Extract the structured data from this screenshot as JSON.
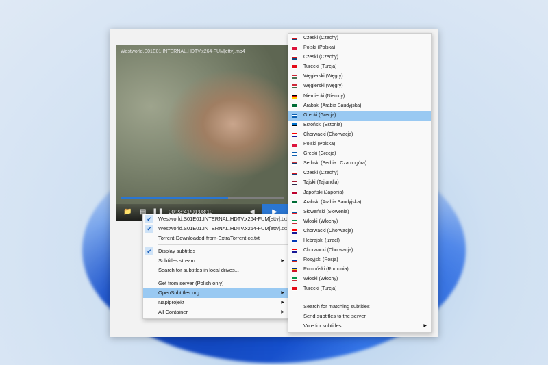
{
  "video": {
    "title": "Westworld.S01E01.INTERNAL.HDTV.x264-FUM[ettv].mp4",
    "time": "00:23:41/01:08:10",
    "progress": 0.66
  },
  "context_menu": {
    "items": [
      {
        "label": "Westworld.S01E01.INTERNAL.HDTV.x264-FUM[ettv].txt",
        "checked": true,
        "submenu": false
      },
      {
        "label": "Westworld.S01E01.INTERNAL.HDTV.x264-FUM[ettv].txt",
        "checked": true,
        "submenu": false
      },
      {
        "label": "Torrent-Downloaded-from-ExtraTorrent.cc.txt",
        "checked": false,
        "submenu": false
      },
      {
        "label": "Display subtitles",
        "checked": true,
        "submenu": false
      },
      {
        "label": "Subtitles stream",
        "checked": false,
        "submenu": true
      },
      {
        "label": "Search for subtitles in local drives...",
        "checked": false,
        "submenu": false
      },
      {
        "label": "Get from server (Polish only)",
        "checked": false,
        "submenu": false
      },
      {
        "label": "OpenSubtitles.org",
        "checked": false,
        "submenu": true
      },
      {
        "label": "Napiprojekt",
        "checked": false,
        "submenu": true
      },
      {
        "label": "All Container",
        "checked": false,
        "submenu": true
      }
    ]
  },
  "languages": [
    {
      "label": "Czeski (Czechy)",
      "flag": [
        "#ffffff",
        "#d7141a",
        "#11457e"
      ]
    },
    {
      "label": "Polski (Polska)",
      "flag": [
        "#ffffff",
        "#dc143c",
        "#dc143c"
      ]
    },
    {
      "label": "Czeski (Czechy)",
      "flag": [
        "#ffffff",
        "#d7141a",
        "#11457e"
      ]
    },
    {
      "label": "Turecki (Turcja)",
      "flag": [
        "#e30a17",
        "#e30a17",
        "#ffffff"
      ]
    },
    {
      "label": "Węgierski (Węgry)",
      "flag": [
        "#ce2939",
        "#ffffff",
        "#477050"
      ]
    },
    {
      "label": "Węgierski (Węgry)",
      "flag": [
        "#ce2939",
        "#ffffff",
        "#477050"
      ]
    },
    {
      "label": "Niemiecki (Niemcy)",
      "flag": [
        "#000000",
        "#dd0000",
        "#ffce00"
      ]
    },
    {
      "label": "Arabski (Arabia Saudyjska)",
      "flag": [
        "#006c35",
        "#006c35",
        "#ffffff"
      ]
    },
    {
      "label": "Grecki (Grecja)",
      "flag": [
        "#0d5eaf",
        "#ffffff",
        "#0d5eaf"
      ]
    },
    {
      "label": "Estoński (Estonia)",
      "flag": [
        "#0072ce",
        "#000000",
        "#ffffff"
      ]
    },
    {
      "label": "Chorwacki (Chorwacja)",
      "flag": [
        "#ff0000",
        "#ffffff",
        "#171796"
      ]
    },
    {
      "label": "Polski (Polska)",
      "flag": [
        "#ffffff",
        "#dc143c",
        "#dc143c"
      ]
    },
    {
      "label": "Grecki (Grecja)",
      "flag": [
        "#0d5eaf",
        "#ffffff",
        "#0d5eaf"
      ]
    },
    {
      "label": "Serbski (Serbia i Czarnogóra)",
      "flag": [
        "#c6363c",
        "#0c4076",
        "#ffffff"
      ]
    },
    {
      "label": "Czeski (Czechy)",
      "flag": [
        "#ffffff",
        "#d7141a",
        "#11457e"
      ]
    },
    {
      "label": "Tajski (Tajlandia)",
      "flag": [
        "#a51931",
        "#ffffff",
        "#2d2a4a"
      ]
    },
    {
      "label": "Japoński (Japonia)",
      "flag": [
        "#ffffff",
        "#bc002d",
        "#ffffff"
      ]
    },
    {
      "label": "Arabski (Arabia Saudyjska)",
      "flag": [
        "#006c35",
        "#006c35",
        "#ffffff"
      ]
    },
    {
      "label": "Słoweński (Słowenia)",
      "flag": [
        "#ffffff",
        "#005da4",
        "#ed1c24"
      ]
    },
    {
      "label": "Włoski (Włochy)",
      "flag": [
        "#009246",
        "#ffffff",
        "#ce2b37"
      ]
    },
    {
      "label": "Chorwacki (Chorwacja)",
      "flag": [
        "#ff0000",
        "#ffffff",
        "#171796"
      ]
    },
    {
      "label": "Hebrajski (Izrael)",
      "flag": [
        "#ffffff",
        "#0038b8",
        "#ffffff"
      ]
    },
    {
      "label": "Chorwacki (Chorwacja)",
      "flag": [
        "#ff0000",
        "#ffffff",
        "#171796"
      ]
    },
    {
      "label": "Rosyjski (Rosja)",
      "flag": [
        "#ffffff",
        "#0039a6",
        "#d52b1e"
      ]
    },
    {
      "label": "Rumuński (Rumunia)",
      "flag": [
        "#002b7f",
        "#fcd116",
        "#ce1126"
      ]
    },
    {
      "label": "Włoski (Włochy)",
      "flag": [
        "#009246",
        "#ffffff",
        "#ce2b37"
      ]
    },
    {
      "label": "Turecki (Turcja)",
      "flag": [
        "#e30a17",
        "#e30a17",
        "#ffffff"
      ]
    }
  ],
  "highlighted_language_index": 8,
  "sub_actions": [
    {
      "label": "Search for matching subtitles",
      "submenu": false
    },
    {
      "label": "Send subtitles to the server",
      "submenu": false
    },
    {
      "label": "Vote for subtitles",
      "submenu": true
    }
  ],
  "icons": {
    "folder": "folder-icon",
    "subtitles": "subtitles-icon",
    "pause": "pause-icon",
    "play": "play-icon",
    "submenu_arrow": "submenu-arrow-icon",
    "check": "check-icon"
  }
}
